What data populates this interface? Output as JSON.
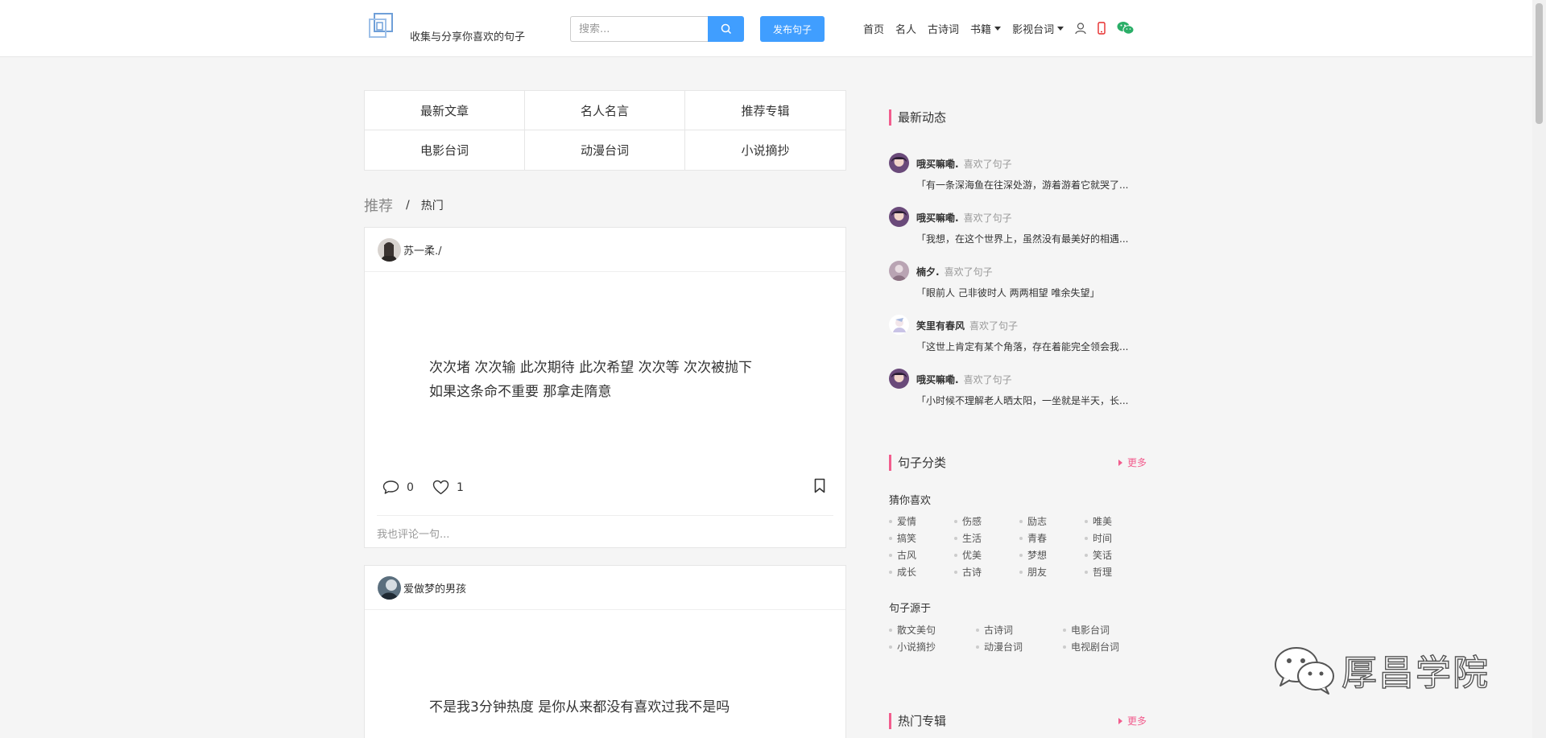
{
  "header": {
    "tagline": "收集与分享你喜欢的句子",
    "search_placeholder": "搜索...",
    "publish_label": "发布句子",
    "nav": [
      {
        "label": "首页",
        "dropdown": false
      },
      {
        "label": "名人",
        "dropdown": false
      },
      {
        "label": "古诗词",
        "dropdown": false
      },
      {
        "label": "书籍",
        "dropdown": true
      },
      {
        "label": "影视台词",
        "dropdown": true
      }
    ],
    "icons": [
      "user-icon",
      "phone-icon",
      "wechat-icon"
    ],
    "colors": {
      "accent": "#409eff",
      "phone": "#e62b2b",
      "wechat": "#2aae67"
    }
  },
  "categories": [
    "最新文章",
    "名人名言",
    "推荐专辑",
    "电影台词",
    "动漫台词",
    "小说摘抄"
  ],
  "tabs": {
    "recommend": "推荐",
    "separator": "/",
    "hot": "热门"
  },
  "posts": [
    {
      "author": "苏一柔./",
      "lines": [
        "次次堵 次次输 此次期待 此次希望 次次等 次次被抛下",
        "如果这条命不重要 那拿走隋意"
      ],
      "comments": "0",
      "likes": "1",
      "comment_placeholder": "我也评论一句..."
    },
    {
      "author": "爱做梦的男孩",
      "lines": [
        "不是我3分钟热度 是你从来都没有喜欢过我不是吗"
      ]
    }
  ],
  "sidebar": {
    "activity_title": "最新动态",
    "activity": [
      {
        "user": "哦买嘛嘞.",
        "action": "喜欢了句子",
        "text": "「有一条深海鱼在往深处游，游着游着它就哭了..."
      },
      {
        "user": "哦买嘛嘞.",
        "action": "喜欢了句子",
        "text": "「我想，在这个世界上，虽然没有最美好的相遇..."
      },
      {
        "user": "楠夕.",
        "action": "喜欢了句子",
        "text": "「眼前人 己非彼时人 两两相望 唯余失望」"
      },
      {
        "user": "笑里有春风",
        "action": "喜欢了句子",
        "text": "「这世上肯定有某个角落，存在着能完全领会我..."
      },
      {
        "user": "哦买嘛嘞.",
        "action": "喜欢了句子",
        "text": "「小时候不理解老人晒太阳，一坐就是半天，长..."
      }
    ],
    "category_title": "句子分类",
    "more_label": "更多",
    "guess_title": "猜你喜欢",
    "guess_tags": [
      "爱情",
      "伤感",
      "励志",
      "唯美",
      "搞笑",
      "生活",
      "青春",
      "时间",
      "古风",
      "优美",
      "梦想",
      "笑话",
      "成长",
      "古诗",
      "朋友",
      "哲理"
    ],
    "source_title": "句子源于",
    "source_tags": [
      "散文美句",
      "古诗词",
      "电影台词",
      "小说摘抄",
      "动漫台词",
      "电视剧台词"
    ],
    "albums_title": "热门专辑",
    "accent": "#f25d8e"
  },
  "watermark": "厚昌学院"
}
